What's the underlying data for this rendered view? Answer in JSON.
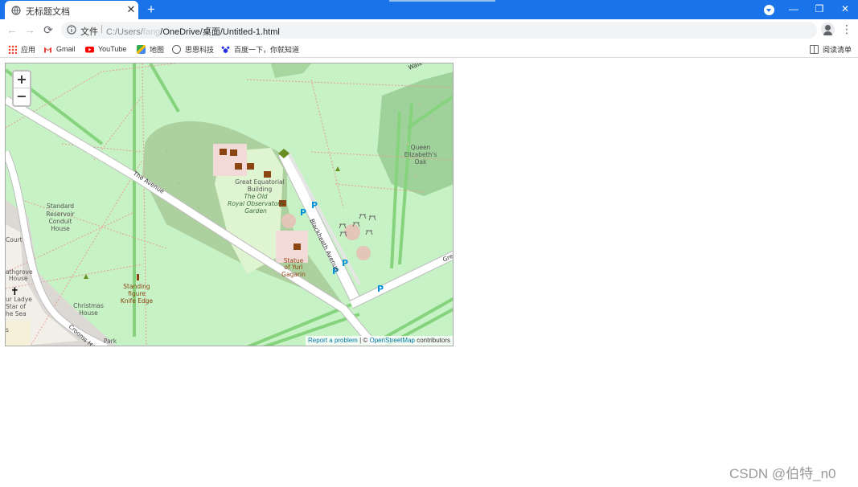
{
  "tab": {
    "title": "无标题文档",
    "close_glyph": "✕",
    "new_tab_glyph": "+"
  },
  "window": {
    "minimize": "—",
    "maximize": "❐",
    "close": "✕"
  },
  "toolbar": {
    "back_glyph": "←",
    "forward_glyph": "→",
    "reload_glyph": "⟳",
    "scheme_label": "文件",
    "url_prefix": "C:/Users/",
    "url_hidden": "fang",
    "url_rest": "/OneDrive/桌面/Untitled-1.html",
    "star_glyph": "☆",
    "menu_glyph": "⋮"
  },
  "bookmarks": {
    "items": [
      {
        "label": "应用",
        "icon": "apps-grid-icon"
      },
      {
        "label": "Gmail",
        "icon": "gmail-icon"
      },
      {
        "label": "YouTube",
        "icon": "youtube-icon"
      },
      {
        "label": "地图",
        "icon": "maps-icon"
      },
      {
        "label": "思恩科技",
        "icon": "globe-icon"
      },
      {
        "label": "百度一下，你就知道",
        "icon": "baidu-paw-icon"
      }
    ],
    "reading_list": {
      "label": "阅读清单",
      "icon": "reading-list-icon"
    }
  },
  "map": {
    "zoom_in": "+",
    "zoom_out": "−",
    "labels": {
      "walk": "Walk",
      "queen": [
        "Queen",
        "Elizabeth's",
        "Oak"
      ],
      "the_avenue": "The Avenue",
      "standard": [
        "Standard",
        "Reservoir",
        "Conduit",
        "House"
      ],
      "great_eq": [
        "Great Equatorial",
        "Building"
      ],
      "old_garden": [
        "The Old",
        "Royal Observatory",
        "Garden"
      ],
      "blackheath": "Blackheath Avenue",
      "statue": [
        "Statue",
        "of Yuri",
        "Gagarin"
      ],
      "standing": [
        "Standing",
        "figure",
        "Knife Edge"
      ],
      "christmas": [
        "Christmas",
        "House"
      ],
      "crooms": "Crooms H",
      "park": "Park",
      "court": "Court",
      "heathgrove": [
        "athgrove",
        "House"
      ],
      "ladye": [
        "ur Ladye",
        "Star of",
        "he Sea"
      ],
      "gre": "Gre",
      "parking": "P",
      "small_s": "s"
    },
    "attribution": {
      "report": "Report a problem",
      "sep": " | © ",
      "osm": "OpenStreetMap",
      "rest": " contributors"
    },
    "colors": {
      "park": "#c6f2c5",
      "wood": "#9fd19a",
      "trees": "#add19e",
      "road": "#ffffff",
      "road_casing": "#bdbdbd",
      "path": "#f1a4a0",
      "heritage": "#8b4513",
      "parking_blue": "#0092da"
    }
  },
  "watermark": "CSDN @伯特_n0"
}
